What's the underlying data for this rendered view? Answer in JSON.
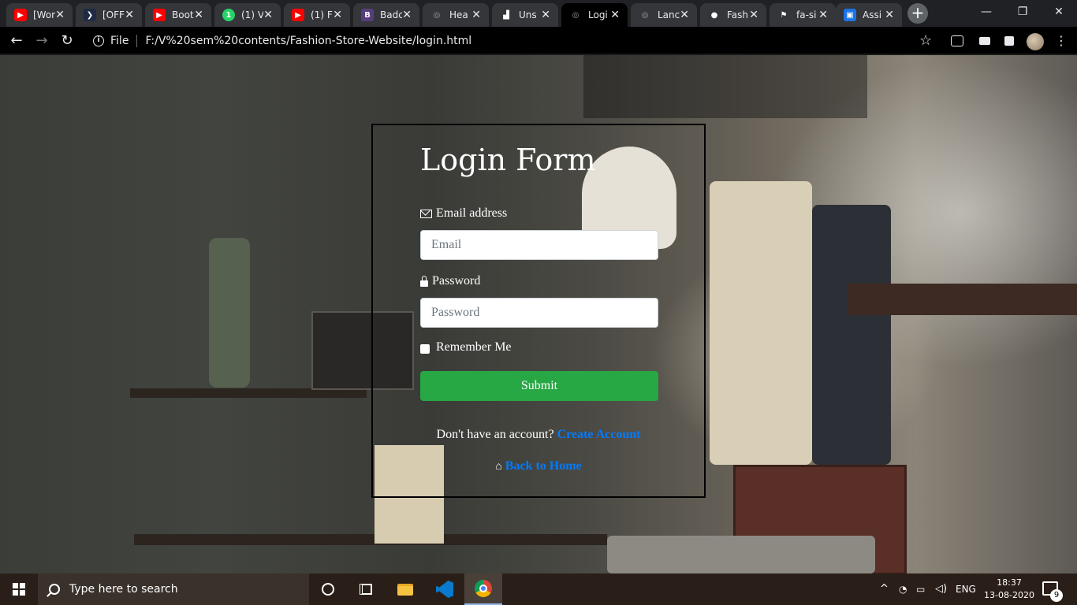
{
  "browser": {
    "tabs": [
      {
        "title": "[Wor",
        "icon": "youtube-icon",
        "color": "#ff0000",
        "glyph": "▶",
        "active": false
      },
      {
        "title": "[OFF",
        "icon": "chevron-icon",
        "color": "#1f2a44",
        "glyph": "❯",
        "active": false
      },
      {
        "title": "Boot",
        "icon": "youtube-icon",
        "color": "#ff0000",
        "glyph": "▶",
        "active": false
      },
      {
        "title": "(1) V",
        "icon": "whatsapp-icon",
        "color": "#25d366",
        "glyph": "1",
        "active": false
      },
      {
        "title": "(1) F",
        "icon": "youtube-icon",
        "color": "#ff0000",
        "glyph": "▶",
        "active": false
      },
      {
        "title": "Badc",
        "icon": "bootstrap-icon",
        "color": "#563d7c",
        "glyph": "B",
        "active": false
      },
      {
        "title": "Hea",
        "icon": "globe-icon",
        "color": "#5f6368",
        "glyph": "◎",
        "active": false
      },
      {
        "title": "Uns",
        "icon": "unsplash-icon",
        "color": "#ffffff",
        "glyph": "▟",
        "active": false
      },
      {
        "title": "Logi",
        "icon": "globe-icon",
        "color": "#5f6368",
        "glyph": "◎",
        "active": true
      },
      {
        "title": "Lanc",
        "icon": "globe-icon",
        "color": "#5f6368",
        "glyph": "◎",
        "active": false
      },
      {
        "title": "Fash",
        "icon": "github-icon",
        "color": "#ffffff",
        "glyph": "●",
        "active": false
      },
      {
        "title": "fa-si",
        "icon": "flag-icon",
        "color": "#ffffff",
        "glyph": "⚑",
        "active": false
      },
      {
        "title": "Assi",
        "icon": "person-icon",
        "color": "#1a73e8",
        "glyph": "▣",
        "active": false
      }
    ],
    "close_glyph": "✕",
    "new_tab_glyph": "+",
    "window_controls": {
      "minimize": "—",
      "restore": "❐",
      "close": "✕"
    },
    "nav": {
      "back": "←",
      "forward": "→",
      "reload": "↻"
    },
    "address": {
      "info": "i",
      "scheme": "File",
      "url": "F:/V%20sem%20contents/Fashion-Store-Website/login.html"
    },
    "star_glyph": "☆",
    "menu_glyph": "⋮"
  },
  "login": {
    "title": "Login Form",
    "email_label": "Email address",
    "email_placeholder": "Email",
    "password_label": "Password",
    "password_placeholder": "Password",
    "remember_label": "Remember Me",
    "submit_label": "Submit",
    "signup_prompt": "Don't have an account? ",
    "signup_link": "Create Account",
    "home_link": "Back to Home",
    "home_glyph": "⌂"
  },
  "taskbar": {
    "search_placeholder": "Type here to search",
    "language": "ENG",
    "time": "18:37",
    "date": "13-08-2020",
    "notification_count": "9",
    "tray_chevron": "^"
  },
  "colors": {
    "submit_green": "#28a745",
    "link_blue": "#007bff"
  }
}
